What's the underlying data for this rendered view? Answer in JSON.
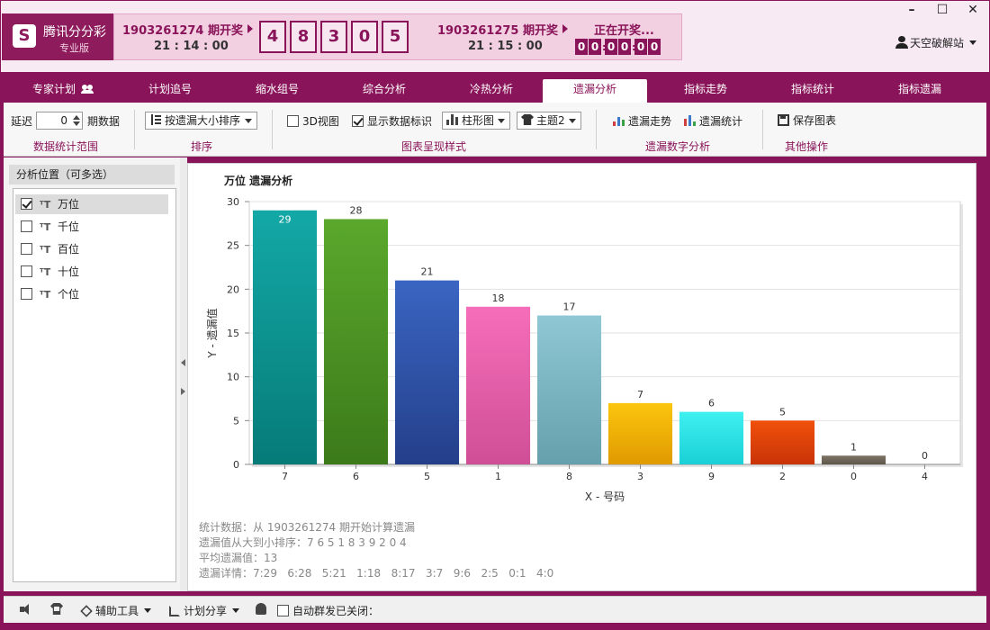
{
  "app": {
    "title": "腾讯分分彩",
    "edition": "专业版"
  },
  "lottery": {
    "current_issue": "1903261274 期开奖",
    "current_time": "21 : 14 : 00",
    "balls": [
      "4",
      "8",
      "3",
      "0",
      "5"
    ],
    "next_issue": "1903261275 期开奖",
    "next_time": "21 : 15 : 00",
    "status": "正在开奖...",
    "countdown": [
      "0",
      "0",
      "0",
      "0",
      "0",
      "0"
    ]
  },
  "window_controls": {
    "minimize": "–",
    "maximize": "☐",
    "close": "✕"
  },
  "user": {
    "name": "天空破解站"
  },
  "tabs": [
    {
      "label": "专家计划"
    },
    {
      "label": "计划追号"
    },
    {
      "label": "缩水组号"
    },
    {
      "label": "综合分析"
    },
    {
      "label": "冷热分析"
    },
    {
      "label": "遗漏分析"
    },
    {
      "label": "指标走势"
    },
    {
      "label": "指标统计"
    },
    {
      "label": "指标遗漏"
    }
  ],
  "active_tab_index": 5,
  "toolbar": {
    "delay_label": "延迟",
    "delay_value": "0",
    "delay_unit": "期数据",
    "range_group": "数据统计范围",
    "sort_option": "按遗漏大小排序",
    "sort_group": "排序",
    "view3d_label": "3D视图",
    "view3d_checked": false,
    "show_labels_label": "显示数据标识",
    "show_labels_checked": true,
    "chart_type": "柱形图",
    "theme": "主题2",
    "style_group": "图表呈现样式",
    "omission_trend": "遗漏走势",
    "omission_stats": "遗漏统计",
    "digit_group": "遗漏数字分析",
    "save_chart": "保存图表",
    "other_group": "其他操作"
  },
  "left_panel": {
    "header": "分析位置（可多选）",
    "items": [
      {
        "label": "万位",
        "checked": true
      },
      {
        "label": "千位",
        "checked": false
      },
      {
        "label": "百位",
        "checked": false
      },
      {
        "label": "十位",
        "checked": false
      },
      {
        "label": "个位",
        "checked": false
      }
    ]
  },
  "chart_data": {
    "type": "bar",
    "title": "万位 遗漏分析",
    "xlabel": "X - 号码",
    "ylabel": "Y - 遗漏值",
    "categories": [
      "7",
      "6",
      "5",
      "1",
      "8",
      "3",
      "9",
      "2",
      "0",
      "4"
    ],
    "values": [
      29,
      28,
      21,
      18,
      17,
      7,
      6,
      5,
      1,
      0
    ],
    "ylim": [
      0,
      30
    ],
    "yticks": [
      0,
      5,
      10,
      15,
      20,
      25,
      30
    ],
    "grid": true,
    "legend": "none",
    "colors": [
      [
        "#13a8a6",
        "#067b78"
      ],
      [
        "#5aa82c",
        "#3c7a1a"
      ],
      [
        "#3a65c2",
        "#243f8a"
      ],
      [
        "#f66db9",
        "#cf4f96"
      ],
      [
        "#8fc8d4",
        "#66a0ad"
      ],
      [
        "#fbc60e",
        "#e09a00"
      ],
      [
        "#3ff0f0",
        "#1ad0d6"
      ],
      [
        "#f0500a",
        "#c93408"
      ],
      [
        "#7d7465",
        "#5e564a"
      ],
      [
        "#999999",
        "#777777"
      ]
    ]
  },
  "stats": {
    "line1": "统计数据：从 1903261274 期开始计算遗漏",
    "line2": "遗漏值从大到小排序：7 6 5 1 8 3 9 2 0 4",
    "line3": "平均遗漏值：13",
    "line4": "遗漏详情：7:29   6:28   5:21   1:18   8:17   3:7   9:6   2:5   0:1   4:0"
  },
  "footer": {
    "tools_label": "辅助工具",
    "share_label": "计划分享",
    "auto_group_label": "自动群发已关闭：",
    "auto_group_checked": false
  },
  "icons": {
    "logo": "app-logo-icon",
    "user": "user-icon",
    "expert_plan": "people-icon",
    "speaker": "speaker-icon",
    "shirt": "shirt-icon",
    "box": "box-icon",
    "share": "share-icon",
    "bell": "bell-icon"
  }
}
